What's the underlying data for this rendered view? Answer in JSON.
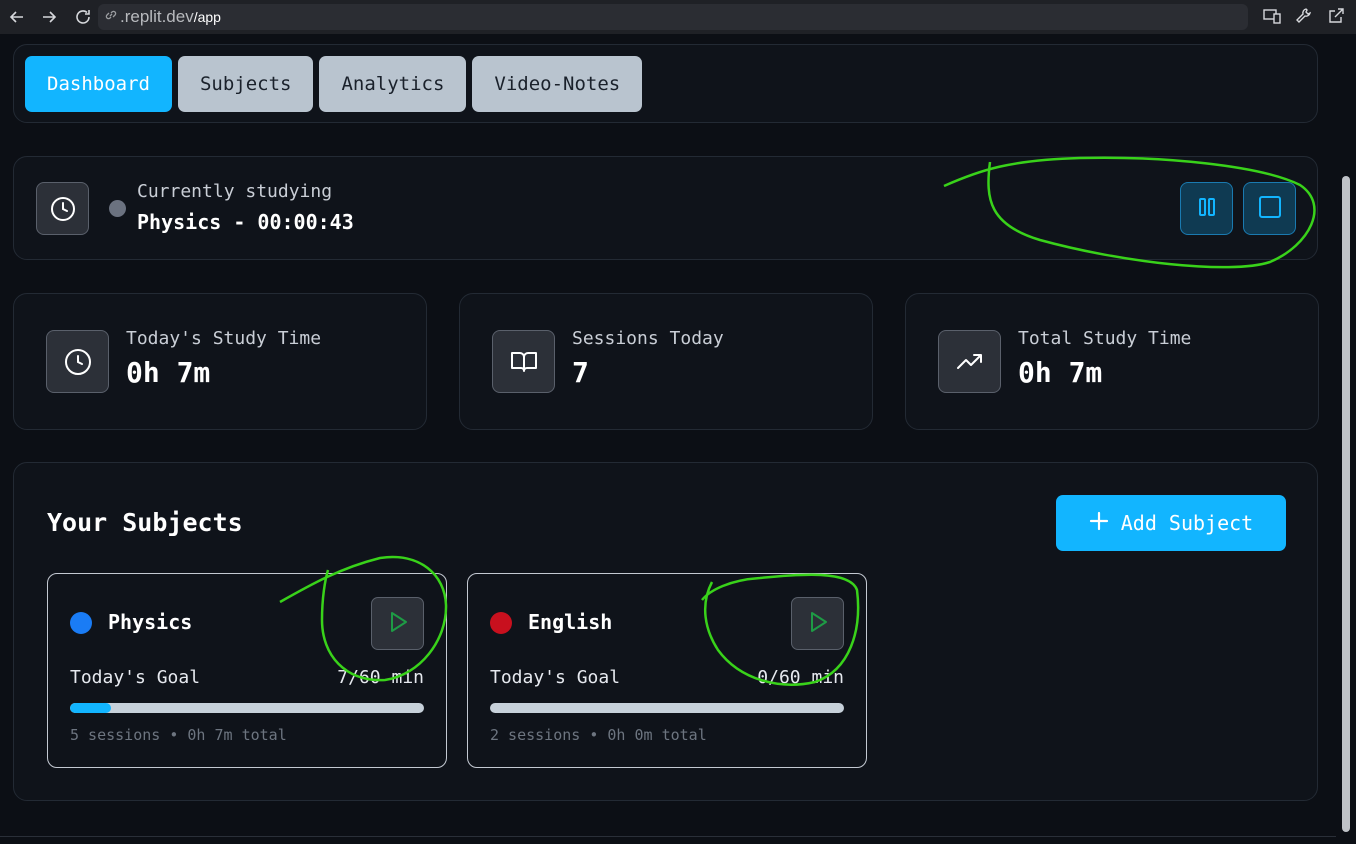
{
  "browser": {
    "url_host": ".replit.dev",
    "url_path": "/app"
  },
  "tabs": [
    {
      "label": "Dashboard",
      "active": true
    },
    {
      "label": "Subjects",
      "active": false
    },
    {
      "label": "Analytics",
      "active": false
    },
    {
      "label": "Video-Notes",
      "active": false
    }
  ],
  "current": {
    "label": "Currently studying",
    "value": "Physics - 00:00:43"
  },
  "stats": [
    {
      "label": "Today's Study Time",
      "value": "0h 7m",
      "icon": "clock-icon"
    },
    {
      "label": "Sessions Today",
      "value": "7",
      "icon": "book-open-icon"
    },
    {
      "label": "Total Study Time",
      "value": "0h 7m",
      "icon": "trending-up-icon"
    }
  ],
  "subjects_section": {
    "title": "Your Subjects",
    "add_button": "Add Subject"
  },
  "subjects": [
    {
      "name": "Physics",
      "color": "#1a7cf5",
      "goal_label": "Today's Goal",
      "goal_value": "7/60 min",
      "progress": 0.117,
      "meta": "5 sessions • 0h 7m total"
    },
    {
      "name": "English",
      "color": "#c8101e",
      "goal_label": "Today's Goal",
      "goal_value": "0/60 min",
      "progress": 0.0,
      "meta": "2 sessions • 0h 0m total"
    }
  ],
  "colors": {
    "accent": "#12b5ff",
    "annotation": "#39d21a"
  }
}
